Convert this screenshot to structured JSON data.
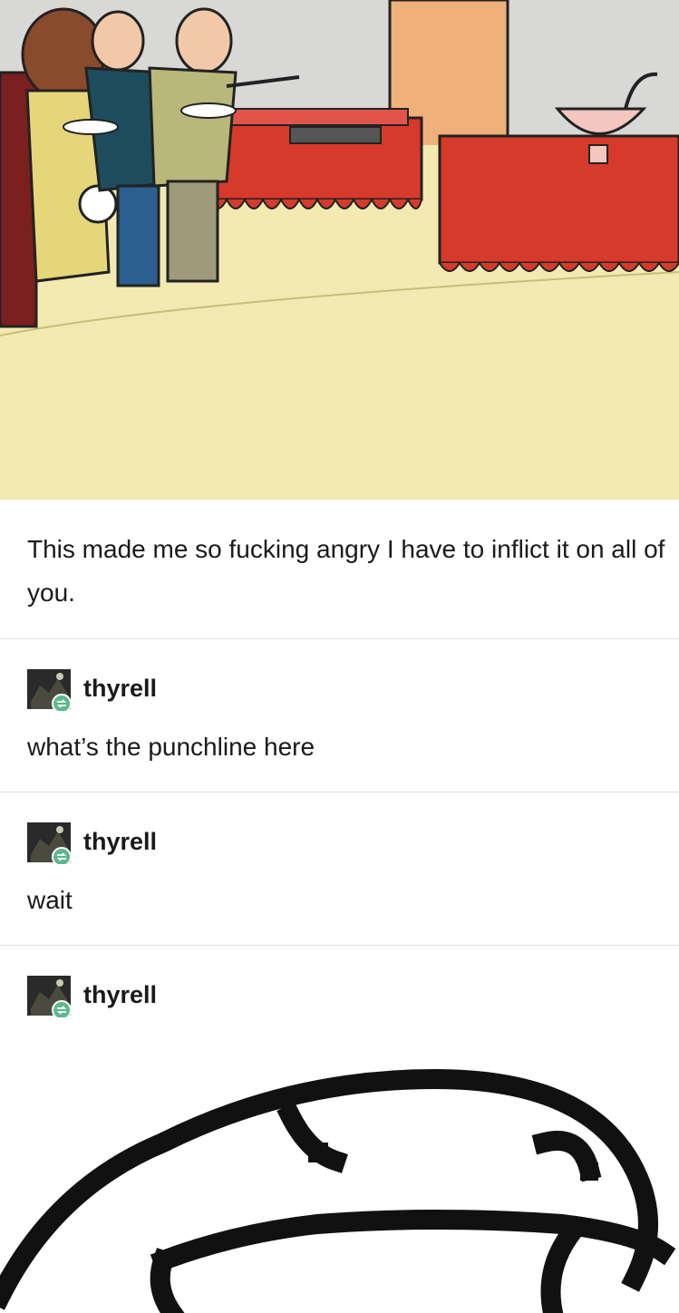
{
  "post": {
    "caption": "This made me so fucking angry I have to inflict it on all of you."
  },
  "reblogs": [
    {
      "username": "thyrell",
      "text": "what’s the punchline here"
    },
    {
      "username": "thyrell",
      "text": "wait"
    },
    {
      "username": "thyrell",
      "text": ""
    }
  ],
  "icons": {
    "avatar": "user-avatar-icon",
    "reblog_badge": "reblog-icon"
  },
  "colors": {
    "reblog_badge": "#5cb88d",
    "table_cloth": "#d63a2b",
    "floor": "#f2eab0",
    "wall": "#d9d9d9"
  }
}
